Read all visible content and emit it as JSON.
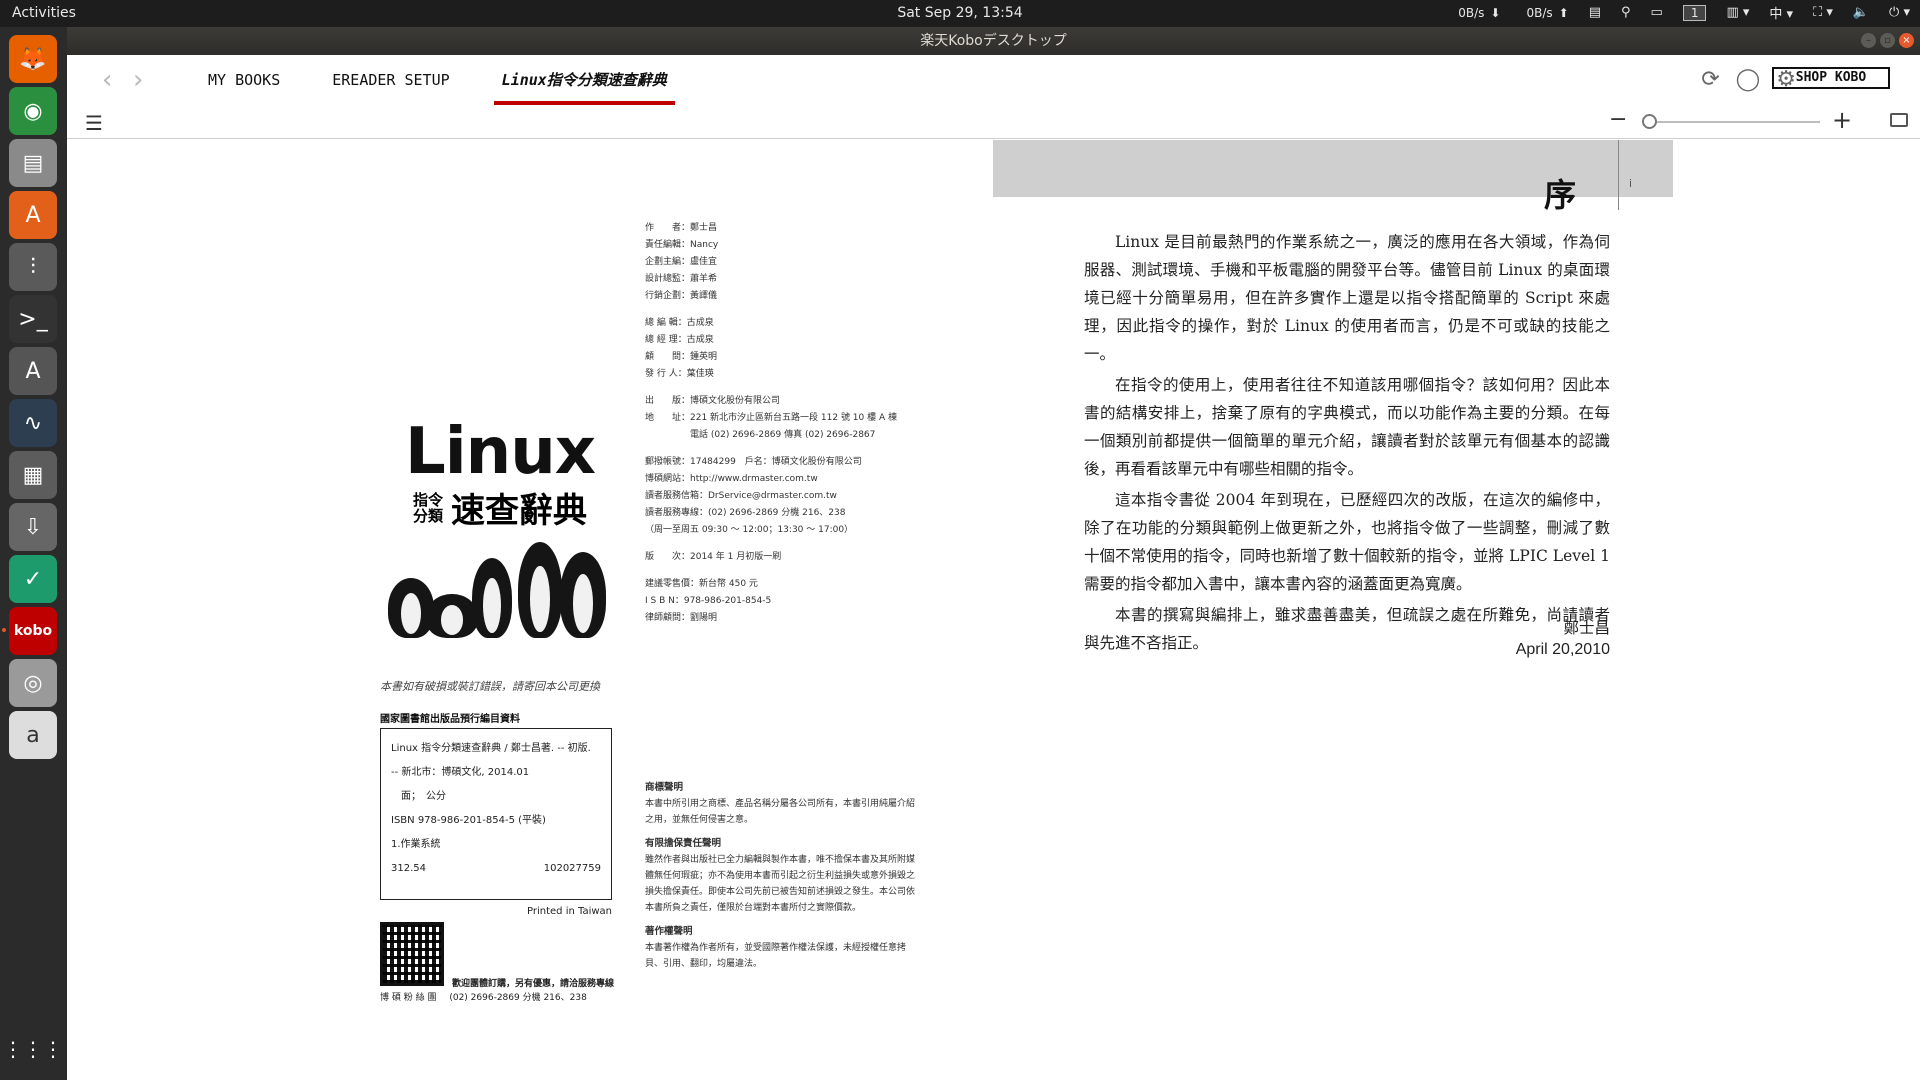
{
  "topbar": {
    "activities": "Activities",
    "clock": "Sat Sep 29, 13:54",
    "net_down": "0B/s",
    "net_up": "0B/s",
    "workspace": "1",
    "input_method": "中"
  },
  "window": {
    "title": "楽天Koboデスクトップ"
  },
  "dock": {
    "items": [
      {
        "name": "firefox",
        "glyph": "🦊",
        "color": "#e66000"
      },
      {
        "name": "chrome",
        "glyph": "◉",
        "color": "#2a8f3e"
      },
      {
        "name": "files",
        "glyph": "▤",
        "color": "#8a8a8a"
      },
      {
        "name": "software-center",
        "glyph": "A",
        "color": "#e2601a"
      },
      {
        "name": "mixer",
        "glyph": "⫶",
        "color": "#5a5a5a"
      },
      {
        "name": "terminal",
        "glyph": ">_",
        "color": "#333"
      },
      {
        "name": "updater",
        "glyph": "A",
        "color": "#555"
      },
      {
        "name": "system-monitor",
        "glyph": "∿",
        "color": "#2c3e50"
      },
      {
        "name": "calculator",
        "glyph": "▦",
        "color": "#5c5c5c"
      },
      {
        "name": "installer",
        "glyph": "⇩",
        "color": "#666"
      },
      {
        "name": "app-green",
        "glyph": "✓",
        "color": "#1e9b6d"
      },
      {
        "name": "kobo",
        "glyph": "kobo",
        "color": "#bf0000"
      },
      {
        "name": "disc",
        "glyph": "◎",
        "color": "#9a9a9a"
      },
      {
        "name": "amazon",
        "glyph": "a",
        "color": "#ddd"
      }
    ],
    "apps_grid": "⋮⋮⋮"
  },
  "header": {
    "tabs": [
      "MY BOOKS",
      "EREADER SETUP",
      "Linux指令分類速查辭典"
    ],
    "shop_label": "SHOP KOBO"
  },
  "left_page": {
    "cover_title": "Linux",
    "cover_small": "指令分類",
    "cover_big": "速查辭典",
    "meta": [
      "作　　者：鄭士昌",
      "責任編輯：Nancy",
      "企劃主編：盧佳宜",
      "設計總監：蕭羊希",
      "行銷企劃：黃譯儀",
      "",
      "總 編 輯：古成泉",
      "總 經 理：古成泉",
      "顧　　問：鍾英明",
      "發 行 人：葉佳瑛",
      "",
      "出　　版：博碩文化股份有限公司",
      "地　　址：221 新北市汐止區新台五路一段 112 號 10 樓 A 棟",
      "　　　　　電話 (02) 2696-2869  傳真 (02) 2696-2867",
      "",
      "郵撥帳號：17484299　戶名：博碩文化股份有限公司",
      "博碩網站：http://www.drmaster.com.tw",
      "讀者服務信箱：DrService@drmaster.com.tw",
      "讀者服務專線：(02) 2696-2869 分機 216、238",
      "（周一至周五 09:30 ～ 12:00；13:30 ～ 17:00）",
      "",
      "版　　次：2014 年 1 月初版一刷",
      "",
      "建議零售價：新台幣 450 元",
      "I S B N：978-986-201-854-5",
      "律師顧問：劉陽明"
    ],
    "notice": "本書如有破損或裝訂錯誤，請寄回本公司更換",
    "cip_title": "國家圖書館出版品預行編目資料",
    "cip_lines": [
      "Linux 指令分類速查辭典 / 鄭士昌著. -- 初版.",
      "-- 新北市：博碩文化, 2014.01",
      "　面；　公分",
      "ISBN 978-986-201-854-5 (平裝)",
      "1.作業系統"
    ],
    "cip_class": "312.54",
    "cip_number": "102027759",
    "printed": "Printed in Taiwan",
    "qr_caption": "博 碩 粉 絲 團",
    "qr_note": "歡迎團體訂購，另有優惠，請洽服務專線",
    "qr_phone": "(02) 2696-2869 分機 216、238",
    "legal": [
      {
        "title": "商標聲明",
        "text": "本書中所引用之商標、產品名稱分屬各公司所有，本書引用純屬介紹之用，並無任何侵害之意。"
      },
      {
        "title": "有限擔保責任聲明",
        "text": "雖然作者與出版社已全力編輯與製作本書，唯不擔保本書及其所附媒體無任何瑕疵；亦不為使用本書而引起之衍生利益損失或意外損毀之損失擔保責任。即使本公司先前已被告知前述損毀之發生。本公司依本書所負之責任，僅限於台端對本書所付之實際價款。"
      },
      {
        "title": "著作權聲明",
        "text": "本書著作權為作者所有，並受國際著作權法保護，未經授權任意拷貝、引用、翻印，均屬違法。"
      }
    ]
  },
  "right_page": {
    "chapter": "序",
    "page_label": "i",
    "paragraphs": [
      "Linux 是目前最熱門的作業系統之一，廣泛的應用在各大領域，作為伺服器、測試環境、手機和平板電腦的開發平台等。儘管目前 Linux 的桌面環境已經十分簡單易用，但在許多實作上還是以指令搭配簡單的 Script 來處理，因此指令的操作，對於 Linux 的使用者而言，仍是不可或缺的技能之一。",
      "在指令的使用上，使用者往往不知道該用哪個指令？該如何用？因此本書的結構安排上，捨棄了原有的字典模式，而以功能作為主要的分類。在每一個類別前都提供一個簡單的單元介紹，讓讀者對於該單元有個基本的認識後，再看看該單元中有哪些相關的指令。",
      "這本指令書從 2004 年到現在，已歷經四次的改版，在這次的編修中，除了在功能的分類與範例上做更新之外，也將指令做了一些調整，刪減了數十個不常使用的指令，同時也新增了數十個較新的指令，並將 LPIC Level 1 需要的指令都加入書中，讓本書內容的涵蓋面更為寬廣。",
      "本書的撰寫與編排上，雖求盡善盡美，但疏誤之處在所難免，尚請讀者與先進不吝指正。"
    ],
    "author": "鄭士昌",
    "date": "April 20,2010"
  }
}
